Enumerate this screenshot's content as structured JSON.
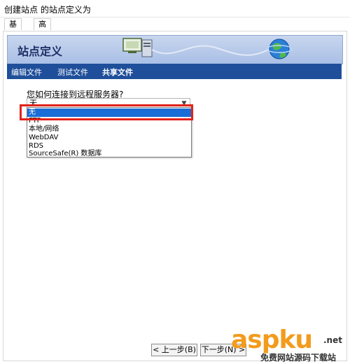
{
  "window": {
    "title": "创建站点 的站点定义为"
  },
  "tabs": [
    {
      "label": "基本"
    },
    {
      "label": "高级"
    }
  ],
  "banner": {
    "title": "站点定义"
  },
  "nav": [
    {
      "label": "编辑文件"
    },
    {
      "label": "测试文件"
    },
    {
      "label": "共享文件"
    }
  ],
  "form": {
    "question": "您如何连接到远程服务器?",
    "selected": "无",
    "options": [
      "无",
      "FTP",
      "本地/网络",
      "WebDAV",
      "RDS",
      "SourceSafe(R) 数据库"
    ]
  },
  "buttons": {
    "back": "< 上一步(B)",
    "next": "下一步(N) >"
  },
  "watermark": {
    "brand": "aspku",
    "net": ".net",
    "tagline": "免费网站源码下载站"
  },
  "colors": {
    "nav_bg": "#1f4f9b",
    "selection": "#1a6dd6",
    "highlight_box": "#e2231a",
    "watermark_orange": "#f29b1d"
  }
}
